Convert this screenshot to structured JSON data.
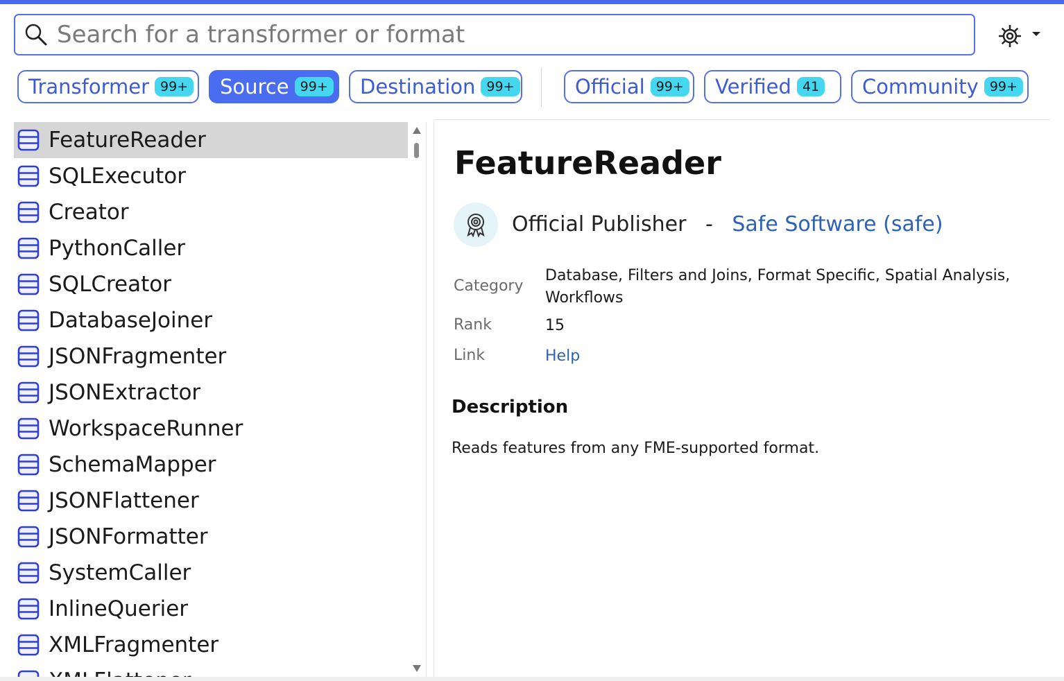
{
  "search": {
    "placeholder": "Search for a transformer or format"
  },
  "filters": {
    "type_chips": [
      {
        "label": "Transformer",
        "count": "99+",
        "active": false
      },
      {
        "label": "Source",
        "count": "99+",
        "active": true
      },
      {
        "label": "Destination",
        "count": "99+",
        "active": false
      }
    ],
    "publisher_chips": [
      {
        "label": "Official",
        "count": "99+",
        "active": false
      },
      {
        "label": "Verified",
        "count": "41",
        "active": false
      },
      {
        "label": "Community",
        "count": "99+",
        "active": false
      }
    ]
  },
  "list": {
    "selected_index": 0,
    "items": [
      "FeatureReader",
      "SQLExecutor",
      "Creator",
      "PythonCaller",
      "SQLCreator",
      "DatabaseJoiner",
      "JSONFragmenter",
      "JSONExtractor",
      "WorkspaceRunner",
      "SchemaMapper",
      "JSONFlattener",
      "JSONFormatter",
      "SystemCaller",
      "InlineQuerier",
      "XMLFragmenter",
      "XMLFlattener"
    ]
  },
  "detail": {
    "title": "FeatureReader",
    "publisher_label": "Official Publisher",
    "publisher_dash": "-",
    "publisher_name": "Safe Software (safe)",
    "category_label": "Category",
    "category_line1": "Database, Filters and Joins, Format Specific, Spatial Analysis,",
    "category_line2": "Workflows",
    "rank_label": "Rank",
    "rank_value": "15",
    "link_label": "Link",
    "link_value": "Help",
    "description_heading": "Description",
    "description_text": "Reads features from any FME-supported format."
  },
  "colors": {
    "accent": "#4a6cf0",
    "badge": "#45d6f0",
    "link": "#2f62b5",
    "selected_row": "#d6d6d6"
  },
  "icons": {
    "search": "search-icon",
    "settings": "gear-icon",
    "list_item": "database-icon",
    "publisher": "award-icon"
  }
}
